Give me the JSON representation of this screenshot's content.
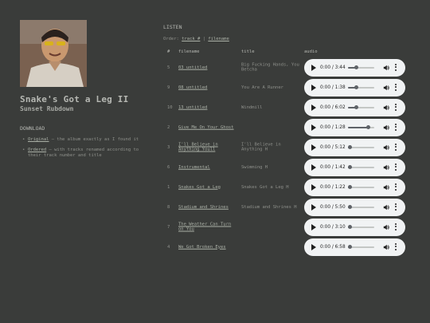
{
  "album": {
    "title": "Snake's Got a Leg II",
    "artist": "Sunset Rubdown"
  },
  "download": {
    "heading": "DOWNLOAD",
    "items": [
      {
        "link": "Original",
        "text": " – the album exactly as I found it"
      },
      {
        "link": "Ordered",
        "text": " – with tracks renamed according to their track number and title"
      }
    ]
  },
  "listen": {
    "heading": "LISTEN",
    "order_prefix": "Order: ",
    "order_options": [
      "track #",
      "filename"
    ],
    "order_sep": " | ",
    "columns": [
      "#",
      "filename",
      "title",
      "audio"
    ],
    "tracks": [
      {
        "num": "5",
        "filename": "03_untitled",
        "title": "Big Fucking Hands, You Betcha",
        "time": "0:00 / 3:44",
        "progress": 0.3
      },
      {
        "num": "9",
        "filename": "08_untitled",
        "title": "You Are A Runner",
        "time": "0:00 / 1:38",
        "progress": 0.3
      },
      {
        "num": "10",
        "filename": "13_untitled",
        "title": "Windmill",
        "time": "0:00 / 6:02",
        "progress": 0.3
      },
      {
        "num": "2",
        "filename": "Give Me On Your Ghost",
        "title": "",
        "time": "0:00 / 1:28",
        "progress": 0.75
      },
      {
        "num": "3",
        "filename": "I'll Believe in Anything Youll",
        "title": "I'll Believe in Anything H",
        "time": "0:00 / 5:12",
        "progress": 0.05
      },
      {
        "num": "6",
        "filename": "Instrumental",
        "title": "Swimming H",
        "time": "0:00 / 1:42",
        "progress": 0.05
      },
      {
        "num": "1",
        "filename": "Snakes Got a Leg",
        "title": "Snakes Got a Leg H",
        "time": "0:00 / 1:22",
        "progress": 0.05
      },
      {
        "num": "8",
        "filename": "Stadium and Shrines",
        "title": "Stadium and Shrines H",
        "time": "0:00 / 5:50",
        "progress": 0.05
      },
      {
        "num": "7",
        "filename": "The Weather Can Turn on You",
        "title": "",
        "time": "0:00 / 3:10",
        "progress": 0.05
      },
      {
        "num": "4",
        "filename": "We Got Broken Eyes",
        "title": "",
        "time": "0:00 / 6:58",
        "progress": 0.05
      }
    ]
  }
}
